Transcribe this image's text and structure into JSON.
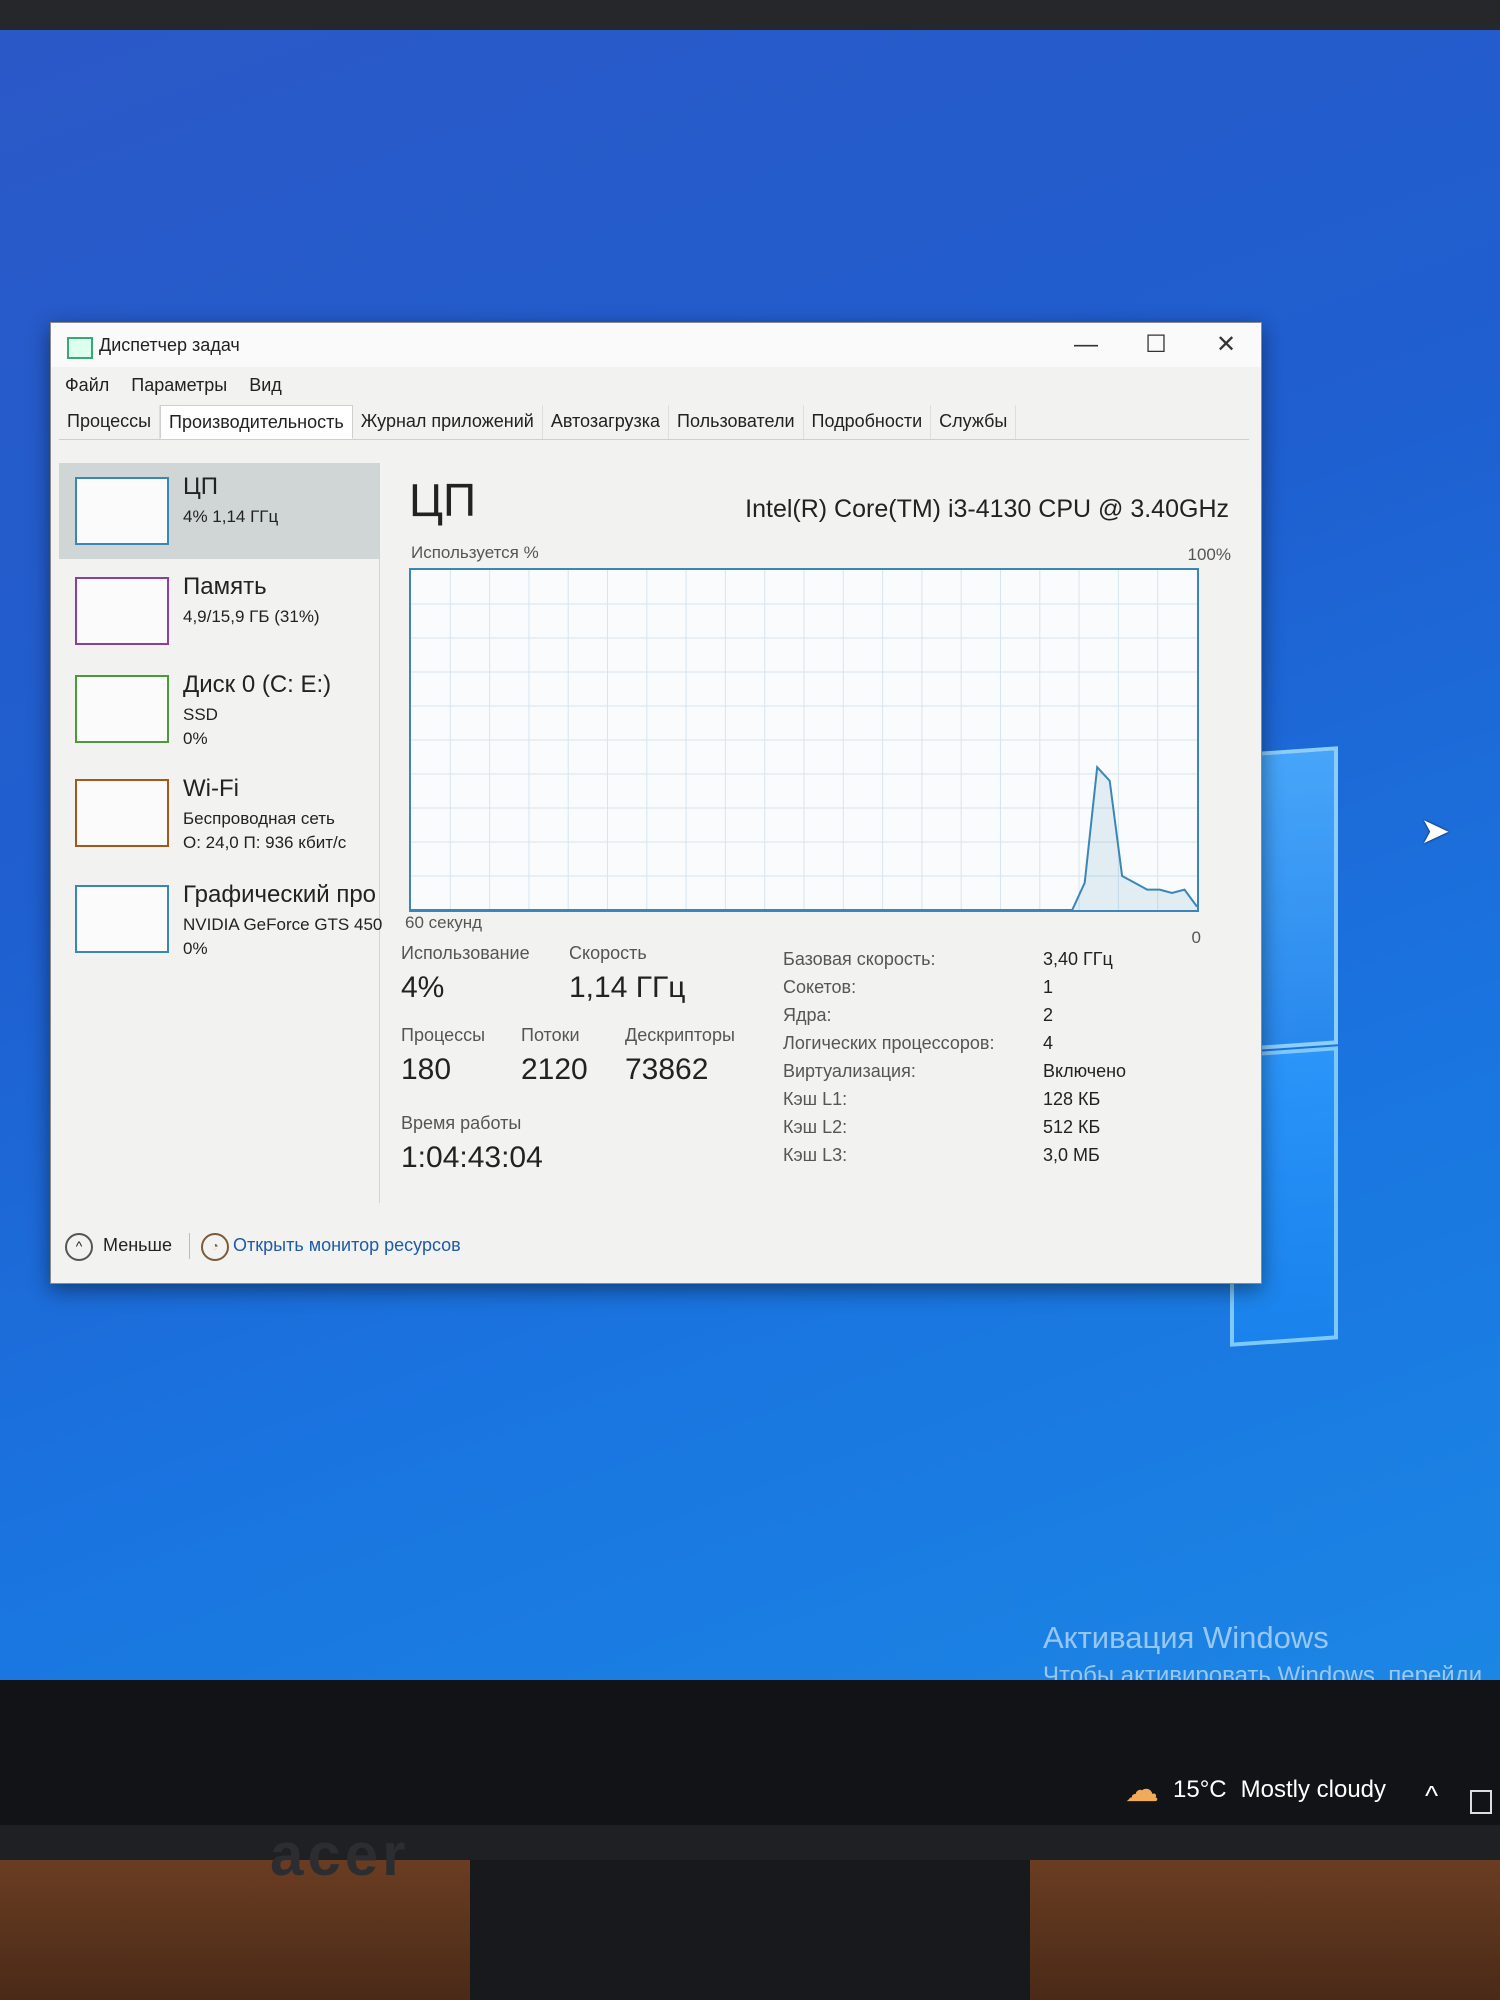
{
  "window": {
    "title": "Диспетчер задач",
    "controls": {
      "minimize": "—",
      "maximize": "☐",
      "close": "✕"
    }
  },
  "menu": [
    "Файл",
    "Параметры",
    "Вид"
  ],
  "tabs": [
    "Процессы",
    "Производительность",
    "Журнал приложений",
    "Автозагрузка",
    "Пользователи",
    "Подробности",
    "Службы"
  ],
  "active_tab": "Производительность",
  "sidebar": {
    "items": [
      {
        "name": "ЦП",
        "line1": "4% 1,14 ГГц",
        "line2": ""
      },
      {
        "name": "Память",
        "line1": "4,9/15,9 ГБ (31%)",
        "line2": ""
      },
      {
        "name": "Диск 0 (C: E:)",
        "line1": "SSD",
        "line2": "0%"
      },
      {
        "name": "Wi-Fi",
        "line1": "Беспроводная сеть",
        "line2": "О: 24,0 П: 936 кбит/с"
      },
      {
        "name": "Графический про",
        "line1": "NVIDIA GeForce GTS 450",
        "line2": "0%"
      }
    ]
  },
  "main": {
    "title": "ЦП",
    "cpu_model": "Intel(R) Core(TM) i3-4130 CPU @ 3.40GHz",
    "graph_label": "Используется %",
    "graph_max": "100%",
    "graph_min": "0",
    "graph_time": "60 секунд",
    "usage_history_percent": [
      0,
      0,
      0,
      0,
      0,
      0,
      0,
      0,
      0,
      0,
      0,
      0,
      0,
      0,
      0,
      0,
      0,
      0,
      0,
      0,
      0,
      0,
      0,
      0,
      0,
      0,
      0,
      0,
      0,
      0,
      0,
      0,
      0,
      0,
      0,
      0,
      0,
      0,
      0,
      0,
      0,
      0,
      0,
      0,
      0,
      0,
      0,
      0,
      0,
      0,
      0,
      0,
      0,
      0,
      8,
      42,
      38,
      10,
      8,
      6,
      6,
      5,
      6,
      1
    ]
  },
  "stats": {
    "usage_label": "Использование",
    "usage_value": "4%",
    "speed_label": "Скорость",
    "speed_value": "1,14 ГГц",
    "processes_label": "Процессы",
    "processes_value": "180",
    "threads_label": "Потоки",
    "threads_value": "2120",
    "handles_label": "Дескрипторы",
    "handles_value": "73862",
    "uptime_label": "Время работы",
    "uptime_value": "1:04:43:04"
  },
  "specs": [
    {
      "k": "Базовая скорость:",
      "v": "3,40 ГГц"
    },
    {
      "k": "Сокетов:",
      "v": "1"
    },
    {
      "k": "Ядра:",
      "v": "2"
    },
    {
      "k": "Логических процессоров:",
      "v": "4"
    },
    {
      "k": "Виртуализация:",
      "v": "Включено"
    },
    {
      "k": "Кэш L1:",
      "v": "128 КБ"
    },
    {
      "k": "Кэш L2:",
      "v": "512 КБ"
    },
    {
      "k": "Кэш L3:",
      "v": "3,0 МБ"
    }
  ],
  "footer": {
    "less": "Меньше",
    "resource_monitor": "Открыть монитор ресурсов"
  },
  "desktop": {
    "activation_title": "Активация Windows",
    "activation_sub": "Чтобы активировать Windows, перейди"
  },
  "taskbar": {
    "temperature": "15°C",
    "weather": "Mostly cloudy"
  },
  "monitor_brand": "acer",
  "colors": {
    "desktop_blue": "#1f5fd0",
    "graph_line": "#3b86b8",
    "link": "#1e5aa8"
  }
}
